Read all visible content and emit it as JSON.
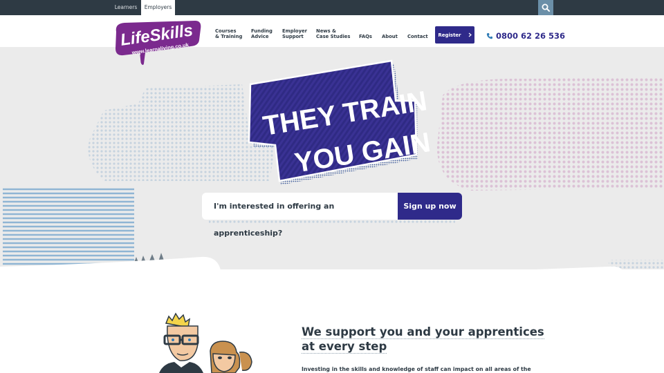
{
  "topbar": {
    "tabs": [
      {
        "label": "Learners",
        "active": false
      },
      {
        "label": "Employers",
        "active": true
      }
    ],
    "search_icon": "search-icon"
  },
  "brand": {
    "name": "LifeSkills",
    "url": "www.learnaliving.co.uk",
    "color": "#7b2a8e"
  },
  "nav": {
    "items": [
      {
        "line1": "Courses",
        "line2": "& Training"
      },
      {
        "line1": "Funding",
        "line2": "Advice"
      },
      {
        "line1": "Employer",
        "line2": "Support"
      },
      {
        "line1": "News &",
        "line2": "Case Studies"
      },
      {
        "line1": "FAQs",
        "line2": ""
      },
      {
        "line1": "About",
        "line2": ""
      },
      {
        "line1": "Contact",
        "line2": ""
      }
    ],
    "register_label": "Register",
    "phone": "0800 62 26 536",
    "accent": "#2f2a8a"
  },
  "hero": {
    "headline_line1": "THEY TRAIN",
    "headline_line2": "YOU GAIN",
    "search_text": "I'm interested in offering an apprenticeship?",
    "cta_label": "Sign up now"
  },
  "section": {
    "title_line1": "We support you and your apprentices",
    "title_line2": "at every step",
    "body": "Investing in the skills and knowledge of staff can impact on all areas of the"
  }
}
